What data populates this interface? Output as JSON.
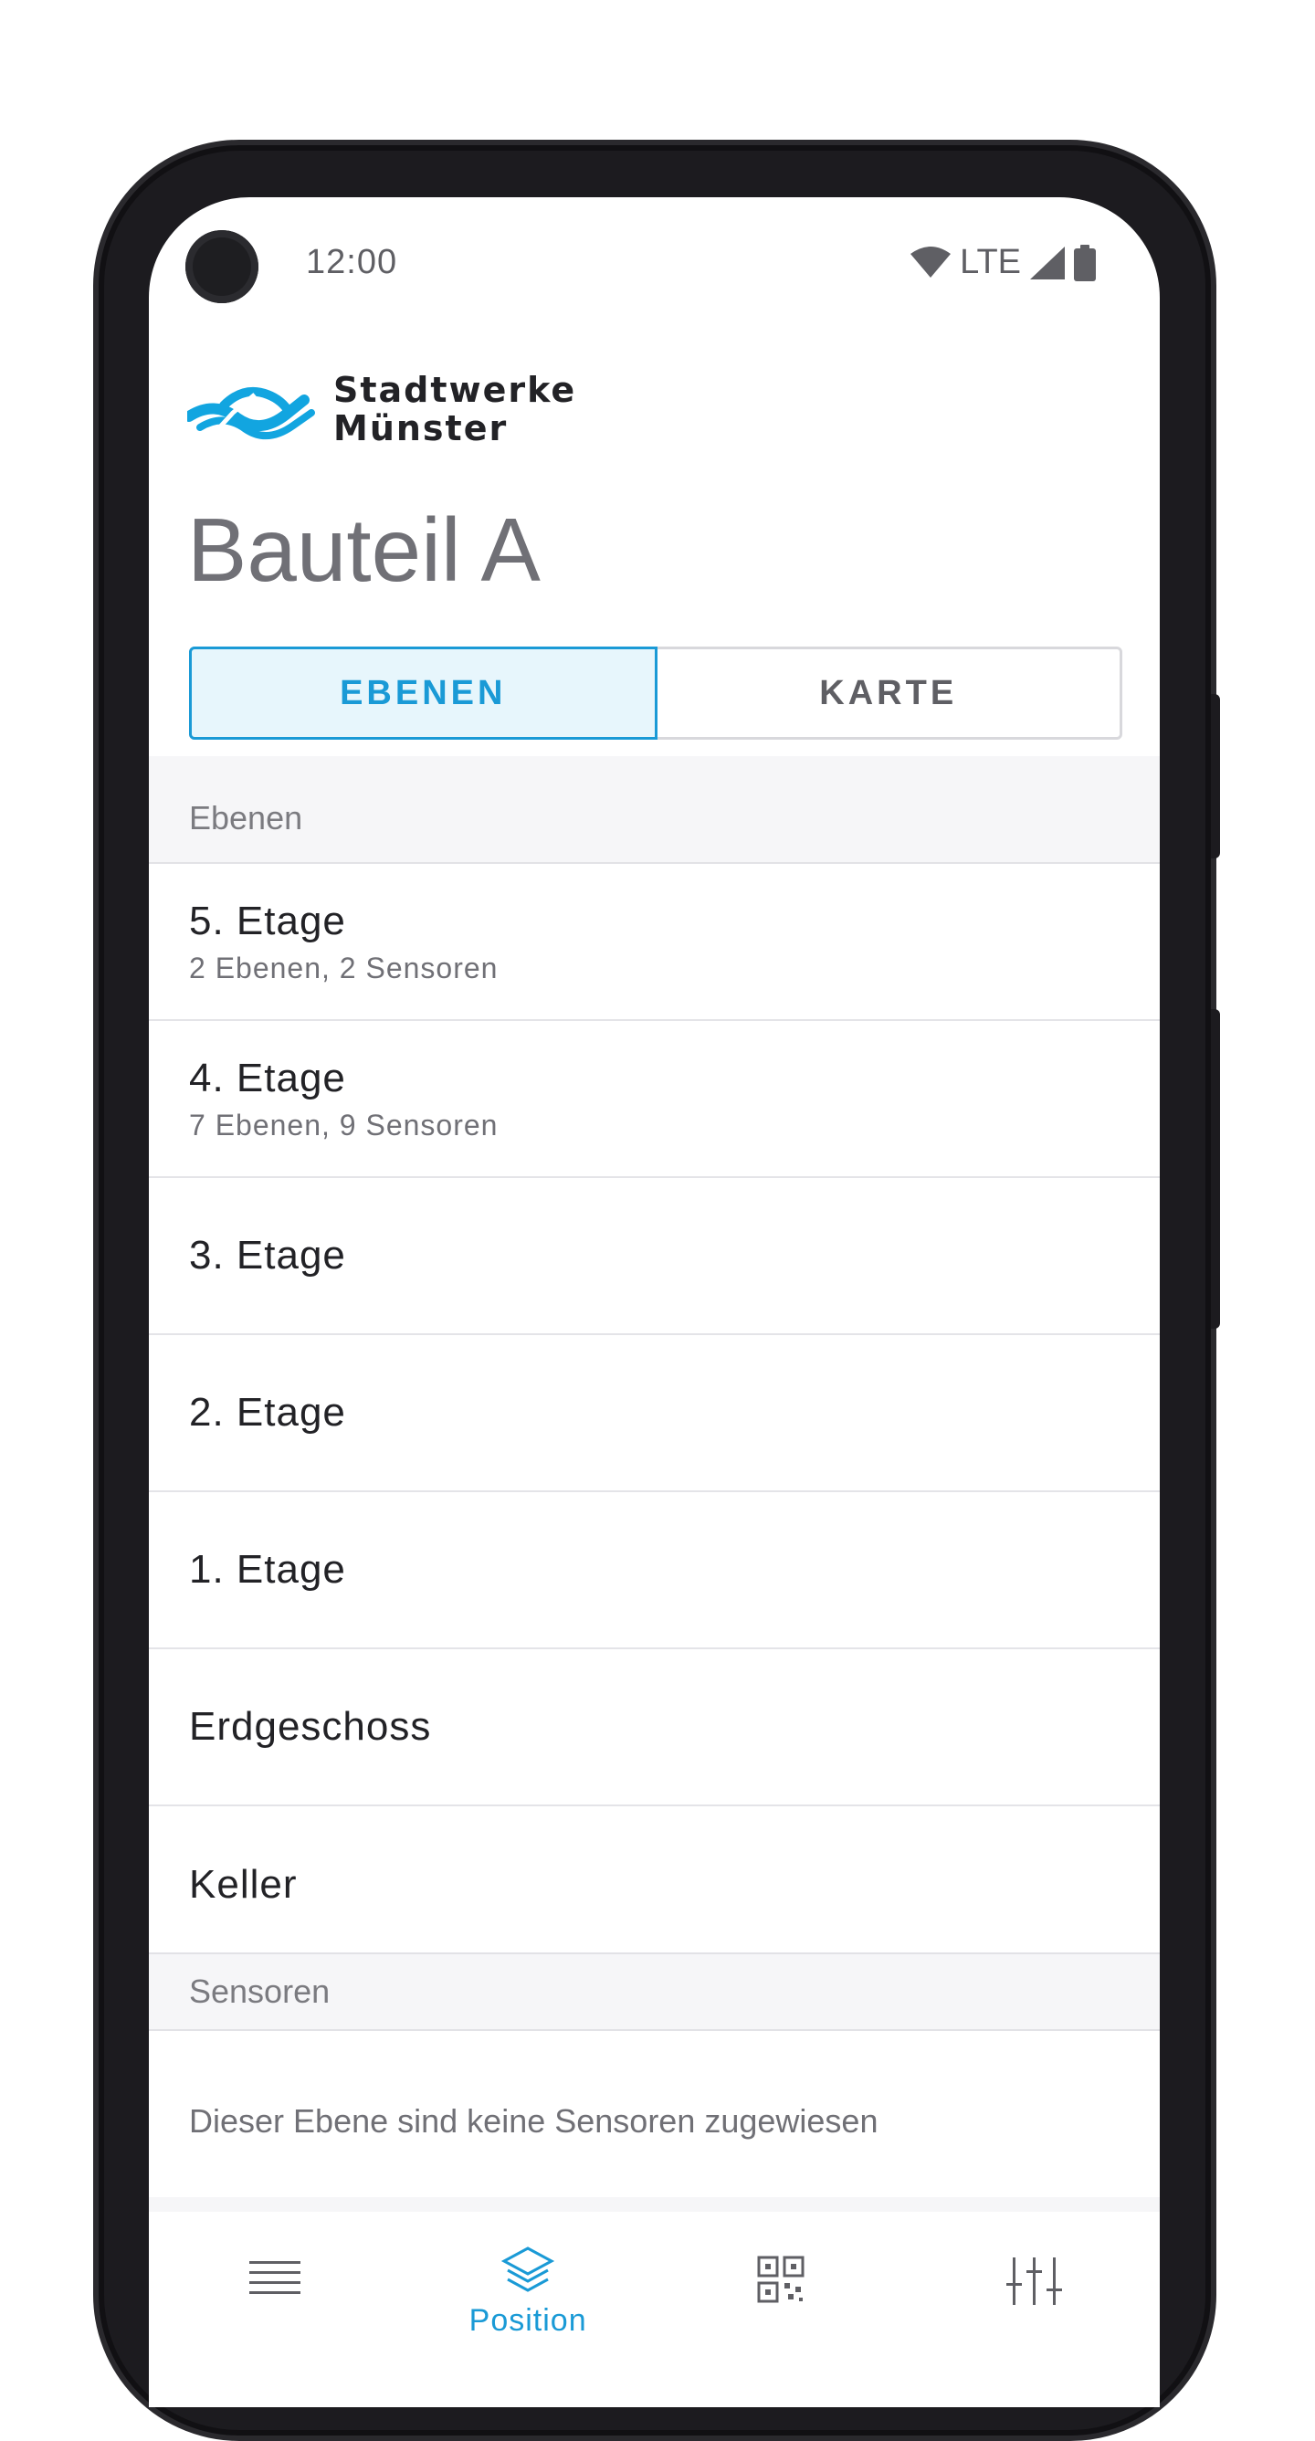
{
  "status_bar": {
    "time": "12:00",
    "network": "LTE",
    "icons": [
      "wifi-icon",
      "signal-icon",
      "battery-icon"
    ]
  },
  "brand": {
    "line1": "Stadtwerke",
    "line2": "Münster",
    "color": "#12a5e0"
  },
  "page": {
    "title": "Bauteil A"
  },
  "segmented": {
    "tabs": [
      {
        "label": "EBENEN",
        "selected": true
      },
      {
        "label": "KARTE",
        "selected": false
      }
    ]
  },
  "sections": {
    "ebenen": "Ebenen",
    "sensoren": "Sensoren"
  },
  "floors": [
    {
      "title": "5. Etage",
      "subtitle": "2 Ebenen, 2 Sensoren"
    },
    {
      "title": "4. Etage",
      "subtitle": "7 Ebenen, 9 Sensoren"
    },
    {
      "title": "3. Etage",
      "subtitle": ""
    },
    {
      "title": "2. Etage",
      "subtitle": ""
    },
    {
      "title": "1. Etage",
      "subtitle": ""
    },
    {
      "title": "Erdgeschoss",
      "subtitle": ""
    },
    {
      "title": "Keller",
      "subtitle": ""
    }
  ],
  "sensors_empty": "Dieser Ebene sind keine Sensoren zugewiesen",
  "bottom_nav": {
    "items": [
      {
        "icon": "menu-icon",
        "label": ""
      },
      {
        "icon": "layers-icon",
        "label": "Position",
        "active": true
      },
      {
        "icon": "qr-code-icon",
        "label": ""
      },
      {
        "icon": "sliders-icon",
        "label": ""
      }
    ]
  },
  "colors": {
    "accent": "#1a9ad6",
    "text_primary": "#222226",
    "text_secondary": "#707076"
  }
}
